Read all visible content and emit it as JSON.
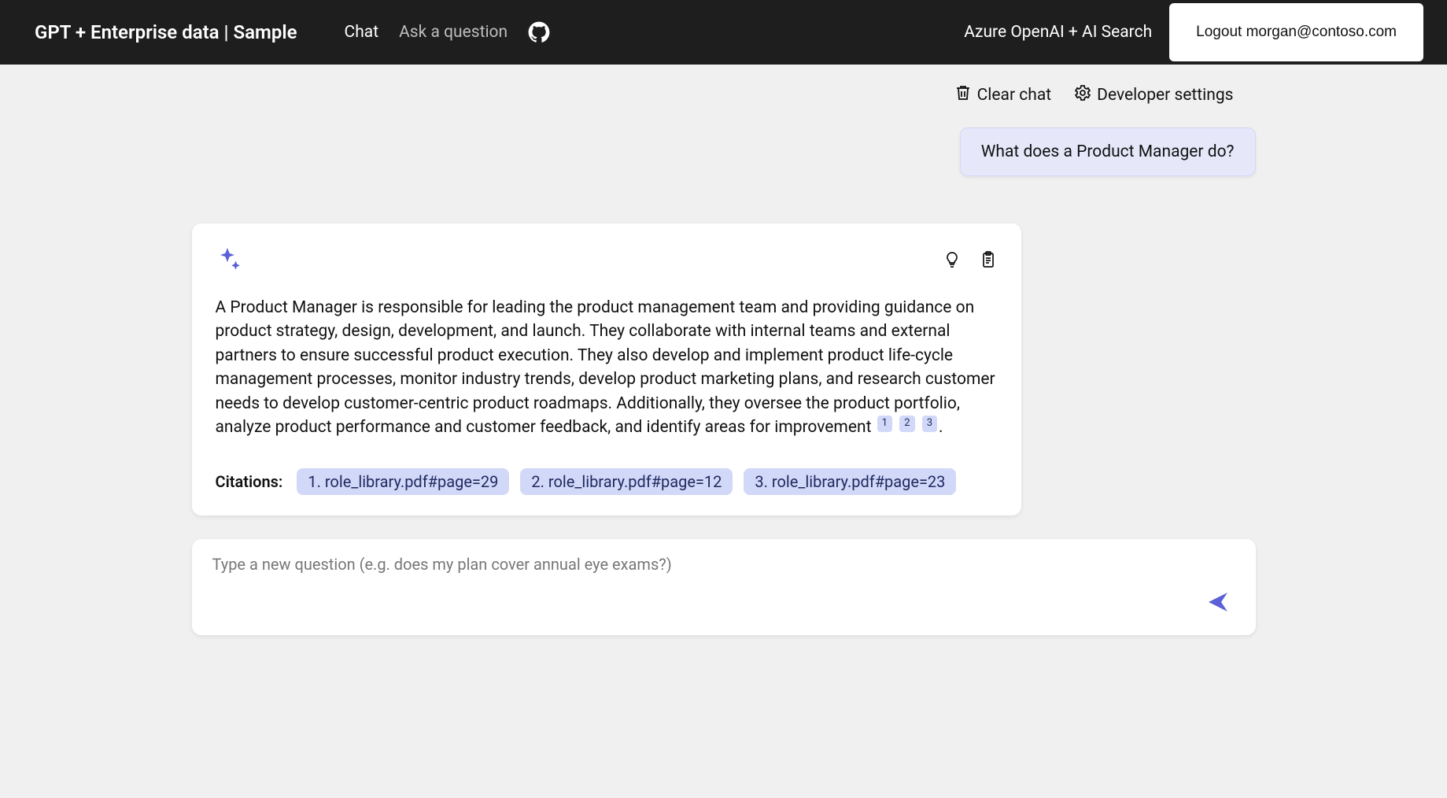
{
  "header": {
    "title": "GPT + Enterprise data | Sample",
    "nav": {
      "chat": "Chat",
      "ask": "Ask a question"
    },
    "tagline": "Azure OpenAI + AI Search",
    "logout_label": "Logout morgan@contoso.com"
  },
  "toolbar": {
    "clear_label": "Clear chat",
    "settings_label": "Developer settings"
  },
  "chat": {
    "user_message": "What does a Product Manager do?",
    "assistant_text": "A Product Manager is responsible for leading the product management team and providing guidance on product strategy, design, development, and launch. They collaborate with internal teams and external partners to ensure successful product execution. They also develop and implement product life-cycle management processes, monitor industry trends, develop product marketing plans, and research customer needs to develop customer-centric product roadmaps. Additionally, they oversee the product portfolio, analyze product performance and customer feedback, and identify areas for improvement",
    "inline_marks": [
      "1",
      "2",
      "3"
    ],
    "citations_label": "Citations:",
    "citations": [
      "1. role_library.pdf#page=29",
      "2. role_library.pdf#page=12",
      "3. role_library.pdf#page=23"
    ]
  },
  "input": {
    "placeholder": "Type a new question (e.g. does my plan cover annual eye exams?)"
  },
  "colors": {
    "accent": "#5b60d8",
    "pill_bg": "#d2d8f8",
    "header_bg": "#1e1e1e"
  }
}
